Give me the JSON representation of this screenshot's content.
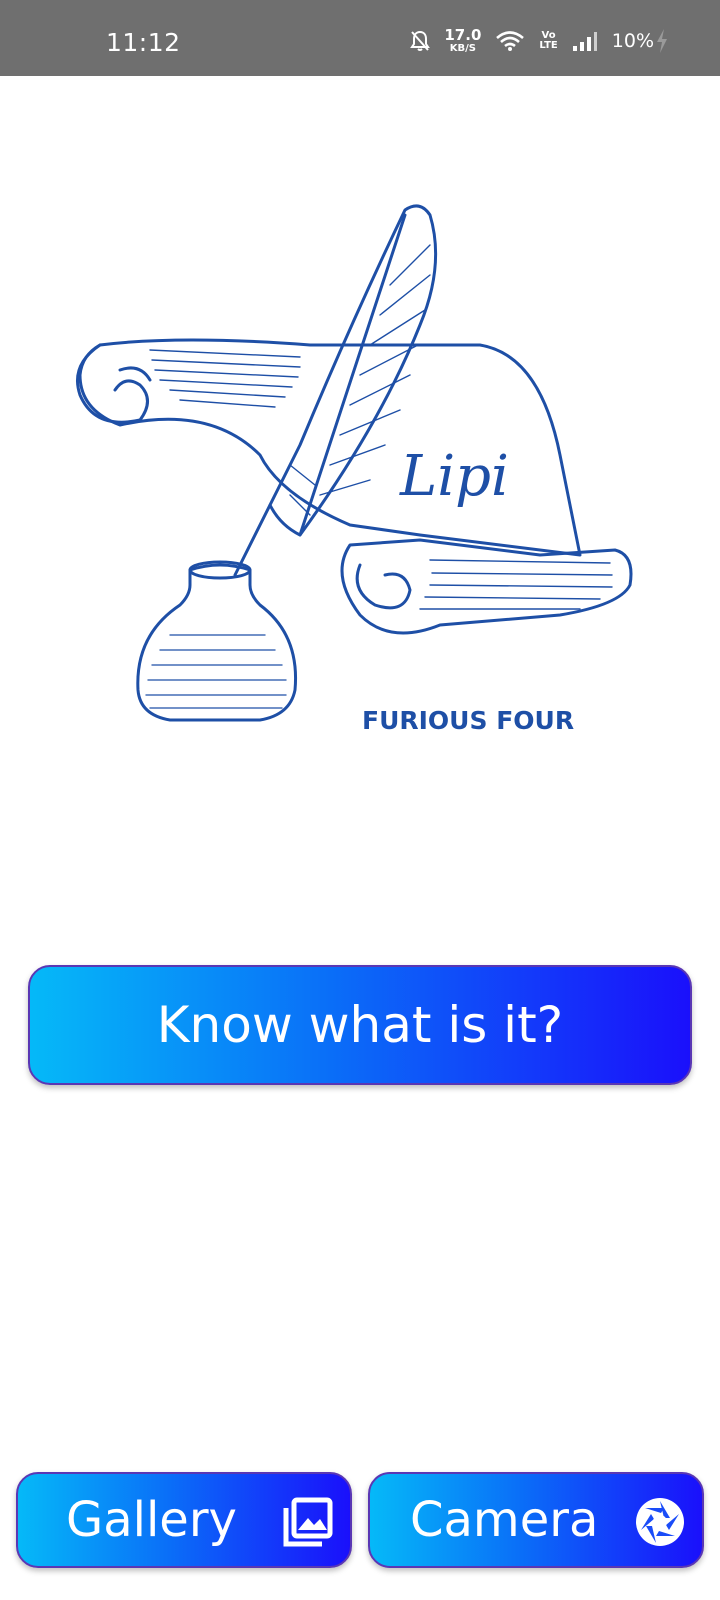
{
  "status_bar": {
    "time": "11:12",
    "net_speed_value": "17.0",
    "net_speed_unit": "KB/S",
    "volte_top": "Vo",
    "volte_bottom": "LTE",
    "battery": "10%",
    "icons": [
      "bell-off-icon",
      "wifi-icon",
      "volte-icon",
      "signal-icon",
      "charging-icon"
    ]
  },
  "logo": {
    "script_text": "Lipi",
    "title": "FURIOUS FOUR",
    "color": "#1e4fa6"
  },
  "main_button": {
    "label": "Know what is it?"
  },
  "bottom_buttons": {
    "gallery_label": "Gallery",
    "gallery_icon": "gallery-icon",
    "camera_label": "Camera",
    "camera_icon": "camera-aperture-icon"
  },
  "colors": {
    "button_gradient_start": "#05b9f8",
    "button_gradient_end": "#1a10fb",
    "button_border": "#5a37b4",
    "status_bar_bg": "#6f6f6f"
  }
}
